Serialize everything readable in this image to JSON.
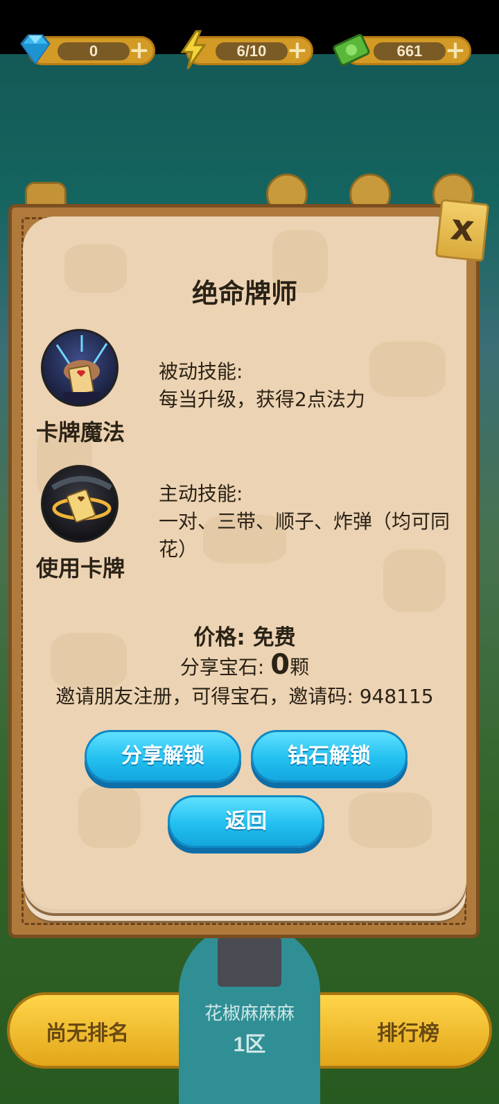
{
  "resources": {
    "gems": "0",
    "energy": "6/10",
    "cash": "661"
  },
  "modal": {
    "title": "绝命牌师",
    "close_icon": "x",
    "skills": [
      {
        "name": "卡牌魔法",
        "type": "被动技能:",
        "description": "每当升级，获得2点法力"
      },
      {
        "name": "使用卡牌",
        "type": "主动技能:",
        "description": "一对、三带、顺子、炸弹（均可同花）"
      }
    ],
    "price": "价格: 免费",
    "share_gems_label": "分享宝石: ",
    "share_gems_value": "0",
    "share_gems_unit": "颗",
    "invite_text": "邀请朋友注册，可得宝石，邀请码: 948115",
    "buttons": {
      "share_unlock": "分享解锁",
      "diamond_unlock": "钻石解锁",
      "back": "返回"
    }
  },
  "bottom": {
    "rank_label": "尚无排名",
    "player_name": "花椒麻麻麻",
    "zone": "1区",
    "leaderboard_label": "排行榜"
  },
  "colors": {
    "paper": "#ecd3b3",
    "frame": "#b07a3c",
    "button_blue": "#22c0f0",
    "text_dark": "#2a2216"
  }
}
